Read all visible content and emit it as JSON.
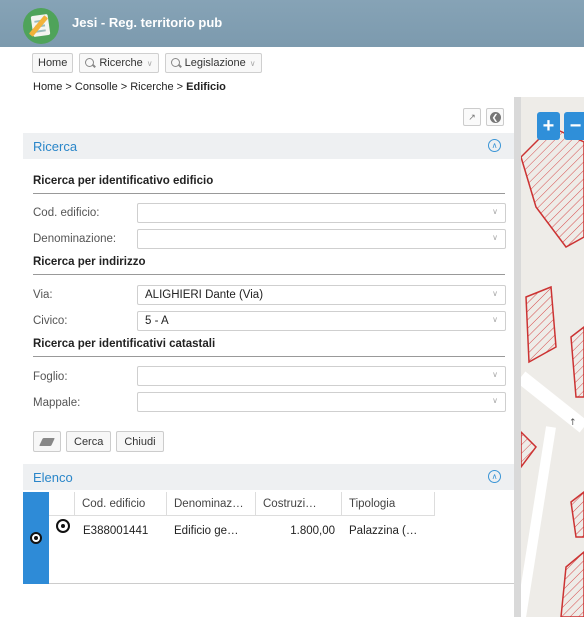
{
  "app": {
    "title": "Jesi - Reg. territorio pub",
    "brand_color": "#7c9aae",
    "accent": "#2a86c9"
  },
  "nav": {
    "home": "Home",
    "ricerche": "Ricerche",
    "legislazione": "Legislazione"
  },
  "breadcrumb": {
    "path": "Home > Consolle > Ricerche > ",
    "current": "Edificio"
  },
  "ricerca": {
    "title": "Ricerca",
    "group_edificio": "Ricerca per identificativo edificio",
    "cod_edificio_label": "Cod. edificio:",
    "denominazione_label": "Denominazione:",
    "group_indirizzo": "Ricerca per indirizzo",
    "via_label": "Via:",
    "via_value": "ALIGHIERI Dante (Via)",
    "civico_label": "Civico:",
    "civico_value": "5 - A",
    "group_catastali": "Ricerca per identificativi catastali",
    "foglio_label": "Foglio:",
    "mappale_label": "Mappale:",
    "cerca": "Cerca",
    "chiudi": "Chiudi"
  },
  "elenco": {
    "title": "Elenco",
    "columns": [
      "Cod. edificio",
      "Denominaz…",
      "Costruzi…",
      "Tipologia"
    ],
    "rows": [
      {
        "cod": "E388001441",
        "denominazione": "Edificio ge…",
        "costruzione": "1.800,00",
        "tipologia": "Palazzina (…"
      }
    ]
  },
  "map": {
    "zoom_in": "+",
    "zoom_out": "−"
  }
}
